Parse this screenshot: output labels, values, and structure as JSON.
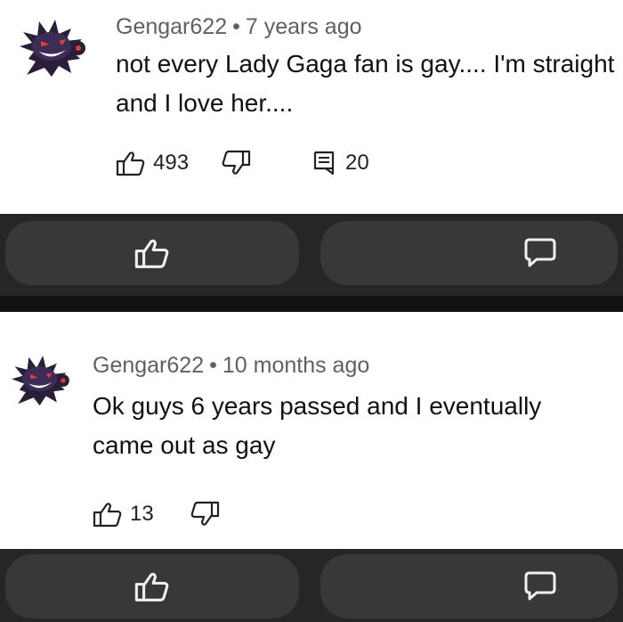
{
  "comments": [
    {
      "username": "Gengar622",
      "separator": "•",
      "time": "7 years ago",
      "text": "not every Lady Gaga fan is gay.... I'm straight and I love her....",
      "likes": "493",
      "replies": "20"
    },
    {
      "username": "Gengar622",
      "separator": "•",
      "time": "10 months ago",
      "text": "Ok guys 6 years passed and I eventually came out as gay",
      "likes": "13"
    }
  ],
  "icons": {
    "avatar": "gengar-avatar-icon",
    "like": "thumbs-up-icon",
    "dislike": "thumbs-down-icon",
    "reply": "reply-icon",
    "comment": "comment-icon"
  },
  "colors": {
    "card_bg": "#ffffff",
    "bar_bg": "#262626",
    "pill_bg": "#383838",
    "meta_text": "#606060"
  }
}
